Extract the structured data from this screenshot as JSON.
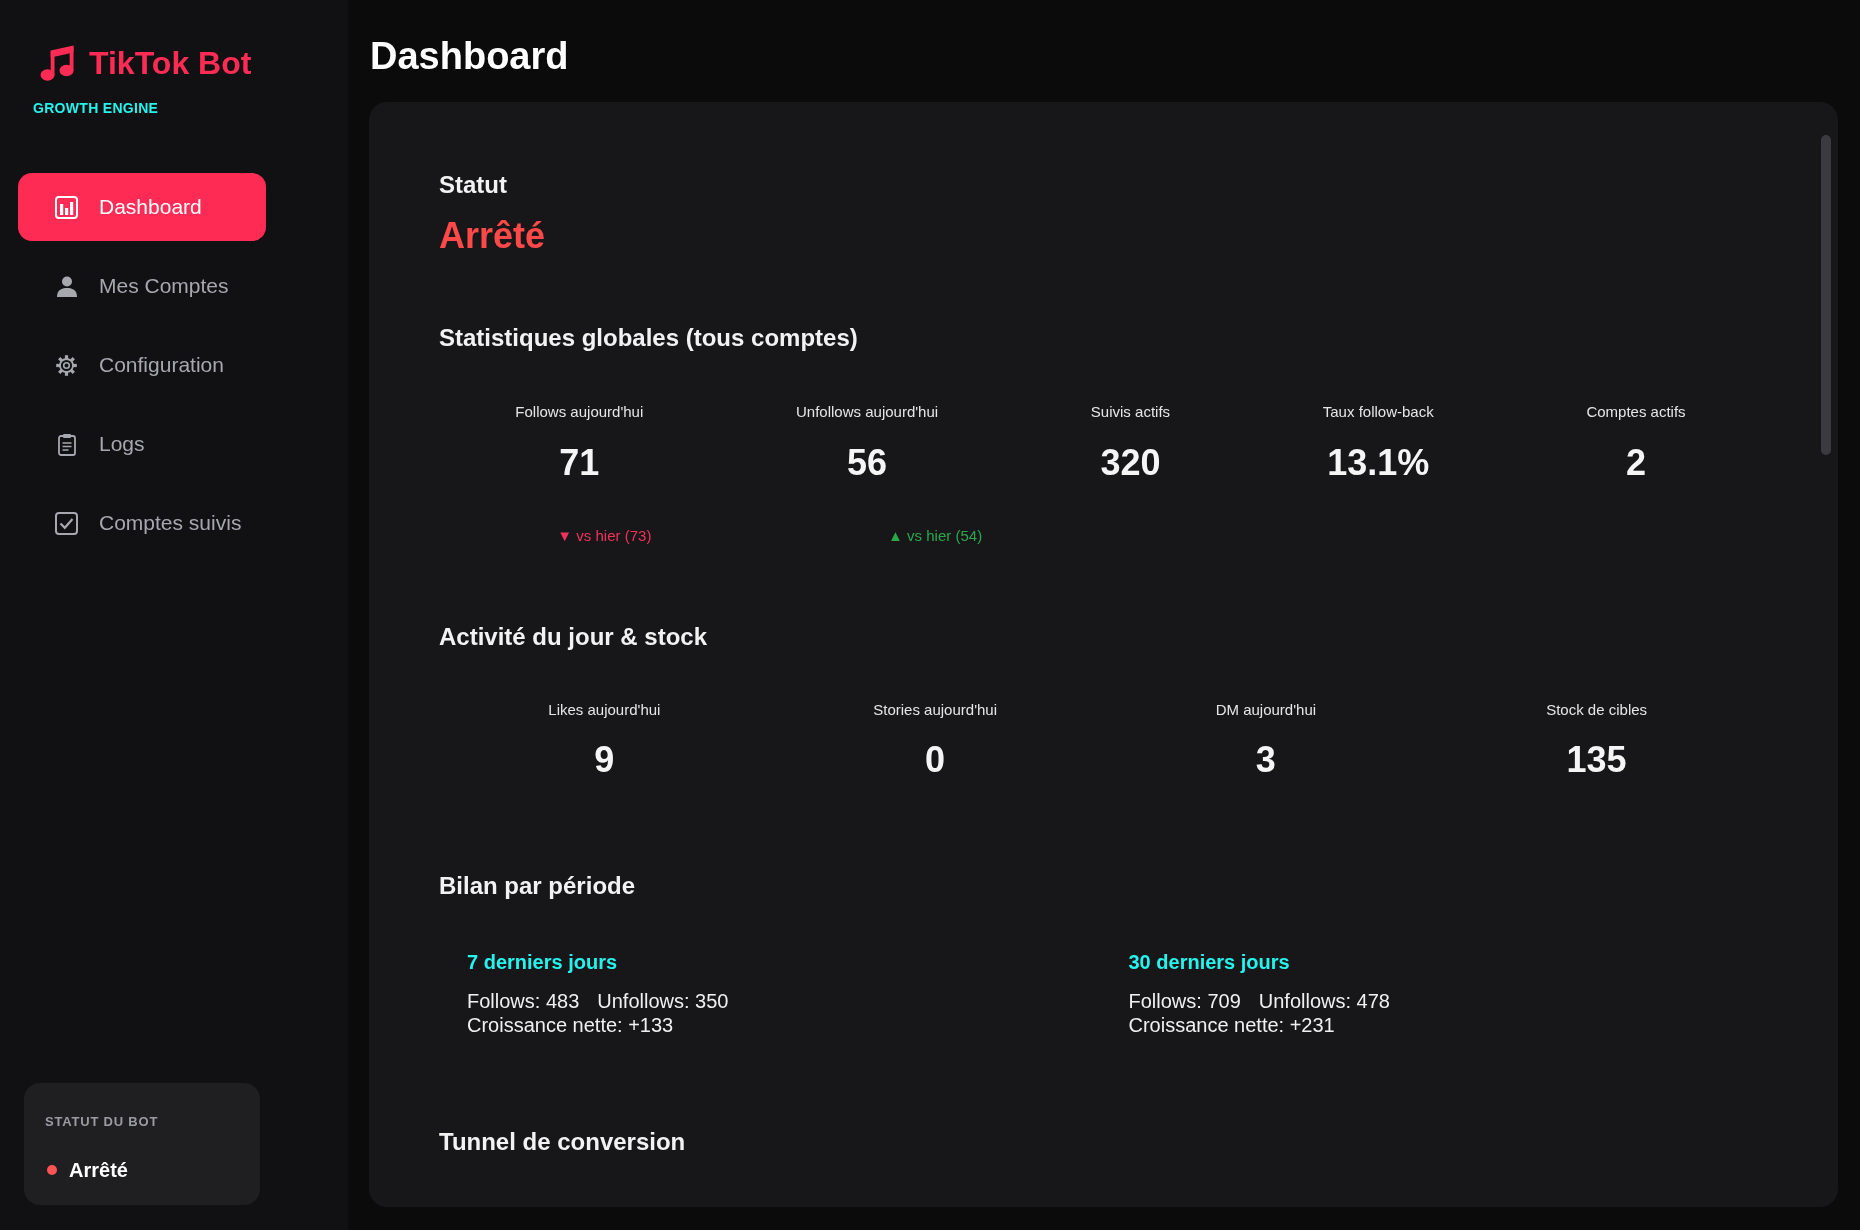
{
  "sidebar": {
    "brand": {
      "title": "TikTok Bot",
      "subtitle": "GROWTH ENGINE"
    },
    "nav": [
      {
        "label": "Dashboard",
        "selected": true
      },
      {
        "label": "Mes Comptes",
        "selected": false
      },
      {
        "label": "Configuration",
        "selected": false
      },
      {
        "label": "Logs",
        "selected": false
      },
      {
        "label": "Comptes suivis",
        "selected": false
      }
    ],
    "bot_status": {
      "label": "STATUT DU BOT",
      "value": "Arrêté",
      "running": false
    }
  },
  "main": {
    "title": "Dashboard",
    "status": {
      "heading": "Statut",
      "value": "Arrêté",
      "running": false
    },
    "global_stats": {
      "heading": "Statistiques globales (tous comptes)",
      "items": [
        {
          "label": "Follows aujourd'hui",
          "value": "71"
        },
        {
          "label": "Unfollows aujourd'hui",
          "value": "56"
        },
        {
          "label": "Suivis actifs",
          "value": "320"
        },
        {
          "label": "Taux follow-back",
          "value": "13.1%"
        },
        {
          "label": "Comptes actifs",
          "value": "2"
        }
      ],
      "trends": [
        {
          "text": "▼ vs hier (73)",
          "rising": false
        },
        {
          "text": "▲ vs hier (54)",
          "rising": true
        }
      ]
    },
    "activity": {
      "heading": "Activité du jour & stock",
      "items": [
        {
          "label": "Likes aujourd'hui",
          "value": "9"
        },
        {
          "label": "Stories aujourd'hui",
          "value": "0"
        },
        {
          "label": "DM aujourd'hui",
          "value": "3"
        },
        {
          "label": "Stock de cibles",
          "value": "135"
        }
      ]
    },
    "period_summary": {
      "heading": "Bilan par période",
      "periods": [
        {
          "title": "7 derniers jours",
          "follows": "Follows: 483",
          "unfollows": "Unfollows: 350",
          "net_growth": "Croissance nette: +133"
        },
        {
          "title": "30 derniers jours",
          "follows": "Follows: 709",
          "unfollows": "Unfollows: 478",
          "net_growth": "Croissance nette: +231"
        }
      ]
    },
    "conversion_funnel": {
      "heading": "Tunnel de conversion"
    }
  }
}
